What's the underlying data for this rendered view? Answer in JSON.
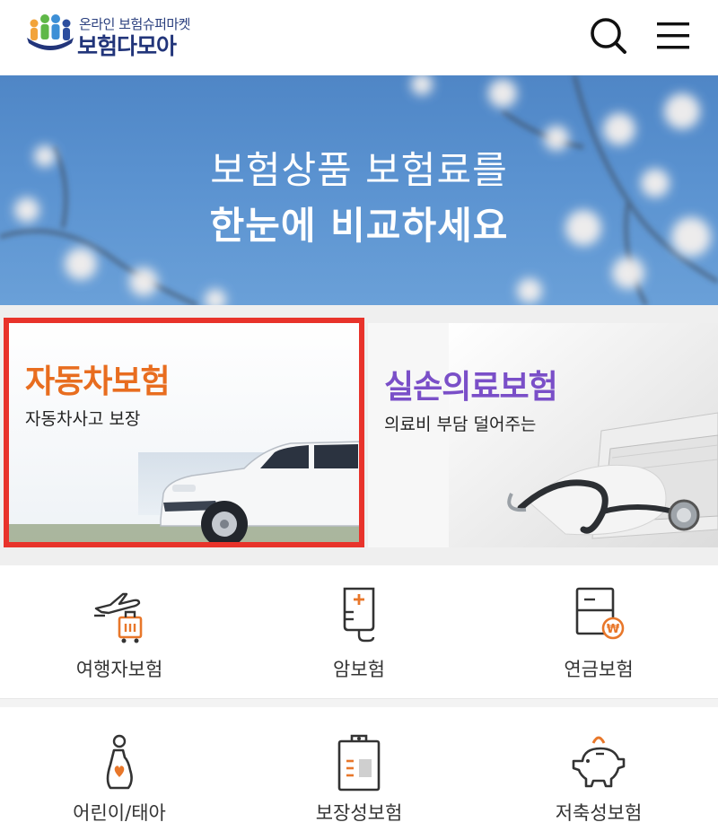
{
  "header": {
    "logo_tagline": "온라인 보험슈퍼마켓",
    "logo_name": "보험다모아"
  },
  "hero": {
    "line1": "보험상품 보험료를",
    "line2": "한눈에 비교하세요"
  },
  "cards": [
    {
      "title": "자동차보험",
      "desc": "자동차사고 보장",
      "accent": "#e86d1f",
      "selected": true
    },
    {
      "title": "실손의료보험",
      "desc": "의료비 부담 덜어주는",
      "accent": "#7a4fc8",
      "selected": false
    }
  ],
  "grid": [
    {
      "label": "여행자보험",
      "icon": "airplane-luggage-icon"
    },
    {
      "label": "암보험",
      "icon": "iv-bag-icon"
    },
    {
      "label": "연금보험",
      "icon": "document-won-icon"
    },
    {
      "label": "어린이/태아",
      "icon": "pregnant-heart-icon"
    },
    {
      "label": "보장성보험",
      "icon": "clipboard-icon"
    },
    {
      "label": "저축성보험",
      "icon": "piggy-bank-icon"
    }
  ],
  "colors": {
    "orange_accent": "#e8772a",
    "selection_border": "#e8332b",
    "brand_navy": "#22357a",
    "sky_blue": "#5a92d0"
  }
}
